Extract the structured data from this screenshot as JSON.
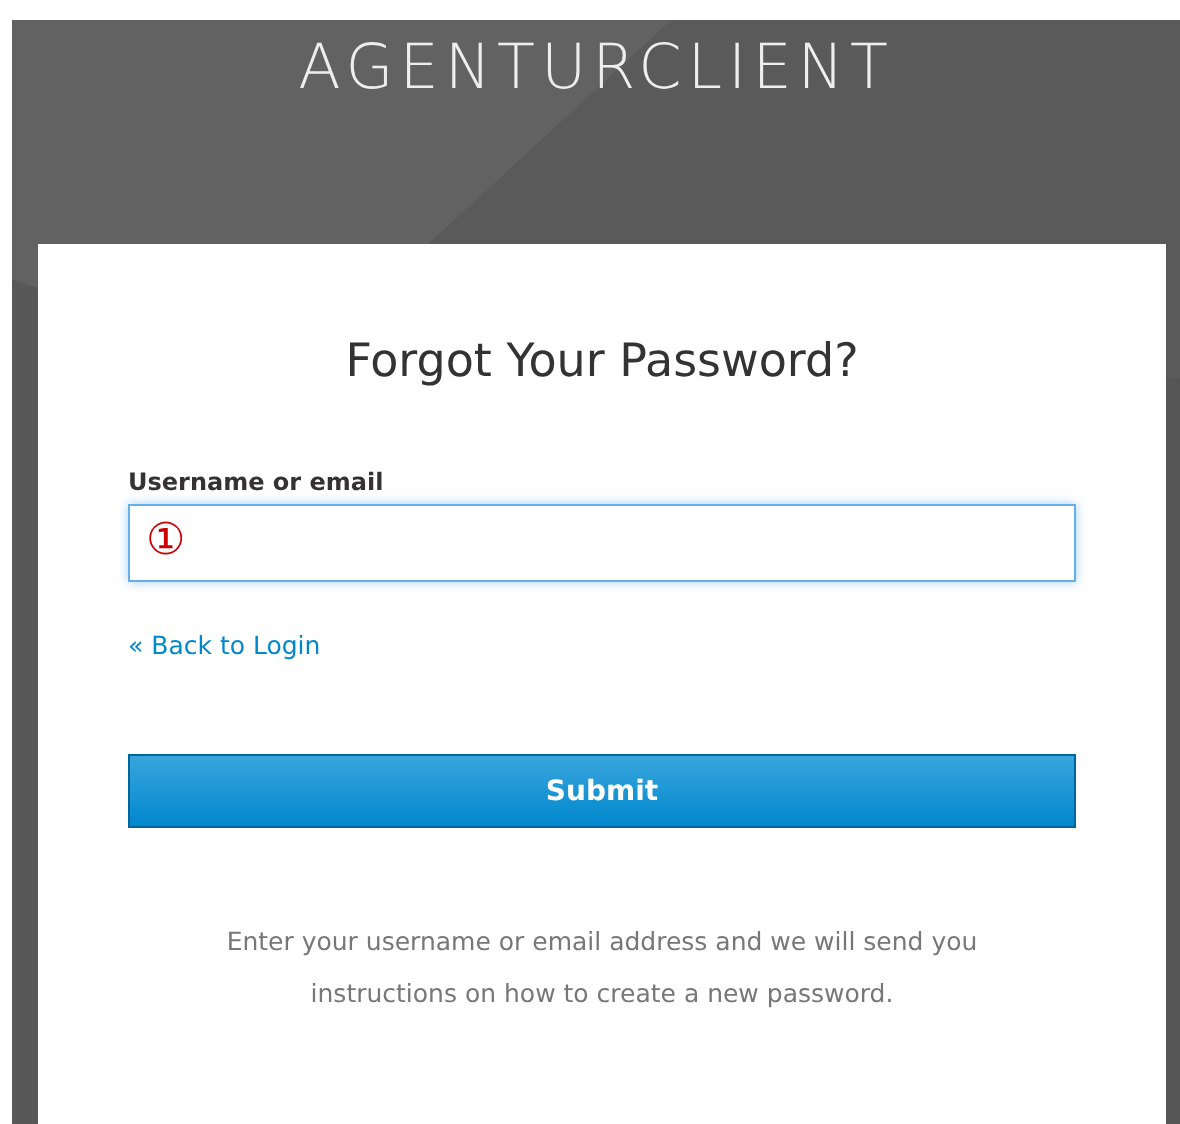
{
  "header": {
    "title": "AGENTURCLIENT"
  },
  "form": {
    "heading": "Forgot Your Password?",
    "field_label": "Username or email",
    "focused": true,
    "callout": "①",
    "back_link": "« Back to Login",
    "submit": "Submit",
    "info": "Enter your username or email address and we will send you instructions on how to create a new password."
  }
}
